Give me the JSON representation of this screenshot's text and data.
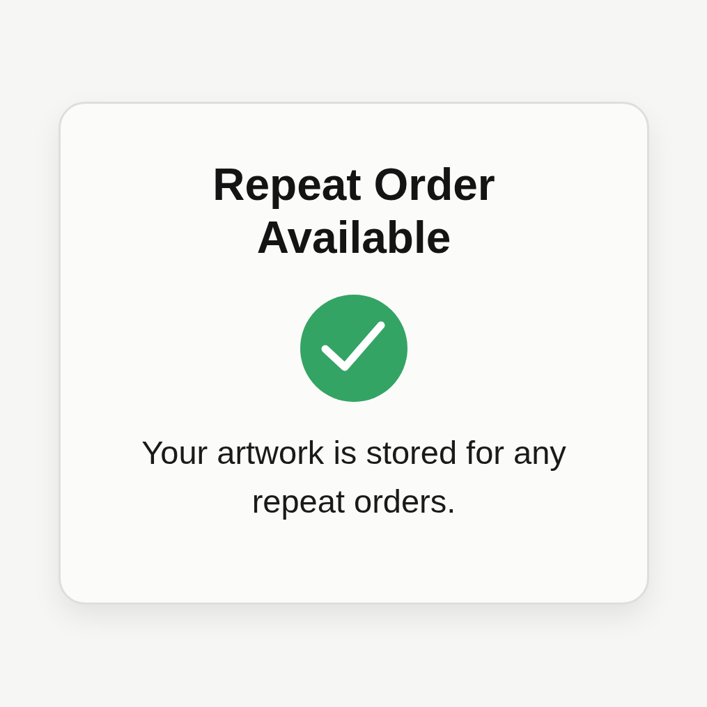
{
  "card": {
    "title": "Repeat Order Available",
    "message": "Your artwork is stored for any repeat orders."
  }
}
